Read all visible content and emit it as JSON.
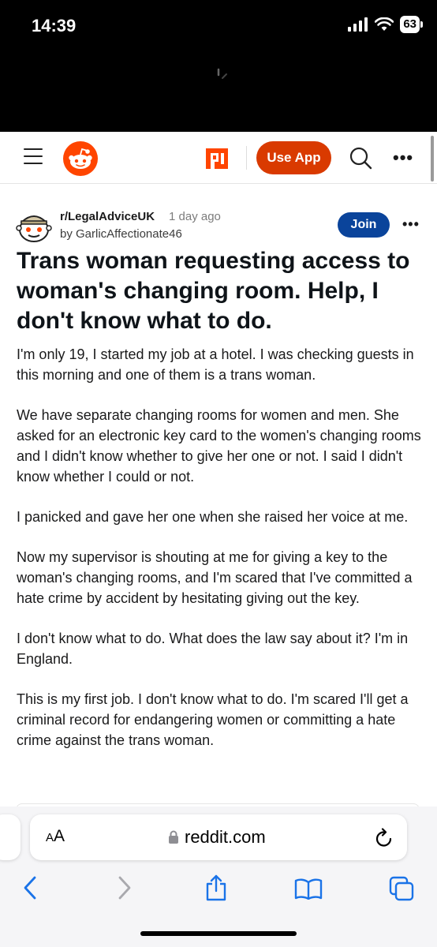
{
  "status_bar": {
    "time": "14:39",
    "battery": "63"
  },
  "header": {
    "use_app_label": "Use App",
    "brand_color": "#ff4500",
    "icons": [
      "menu-icon",
      "reddit-logo-icon",
      "popular-icon",
      "search-icon",
      "more-icon"
    ]
  },
  "post": {
    "subreddit": "r/LegalAdviceUK",
    "time_ago": "1 day ago",
    "author": "by GarlicAffectionate46",
    "join_label": "Join",
    "title": "Trans woman requesting access to woman's changing room. Help, I don't know what to do.",
    "paragraphs": [
      "I'm only 19, I started my job at a hotel. I was checking guests in this morning and one of them is a trans woman.",
      "We have separate changing rooms for women and men. She asked for an electronic key card to the women's changing rooms and I didn't know whether to give her one or not. I said I didn't know whether I could or not.",
      "I panicked and gave her one when she raised her voice at me.",
      "Now my supervisor is shouting at me for giving a key to the woman's changing rooms, and I'm scared that I've committed a hate crime by accident by hesitating giving out the key.",
      "I don't know what to do. What does the law say about it? I'm in England.",
      "This is my first job. I don't know what to do. I'm scared I'll get a criminal record for endangering women or committing a hate crime against the trans woman."
    ]
  },
  "browser": {
    "aa_small": "A",
    "aa_large": "A",
    "url": "reddit.com",
    "accent_color": "#1a73e8",
    "toolbar_icons": [
      "back-icon",
      "forward-icon",
      "share-icon",
      "bookmarks-icon",
      "tabs-icon"
    ]
  }
}
